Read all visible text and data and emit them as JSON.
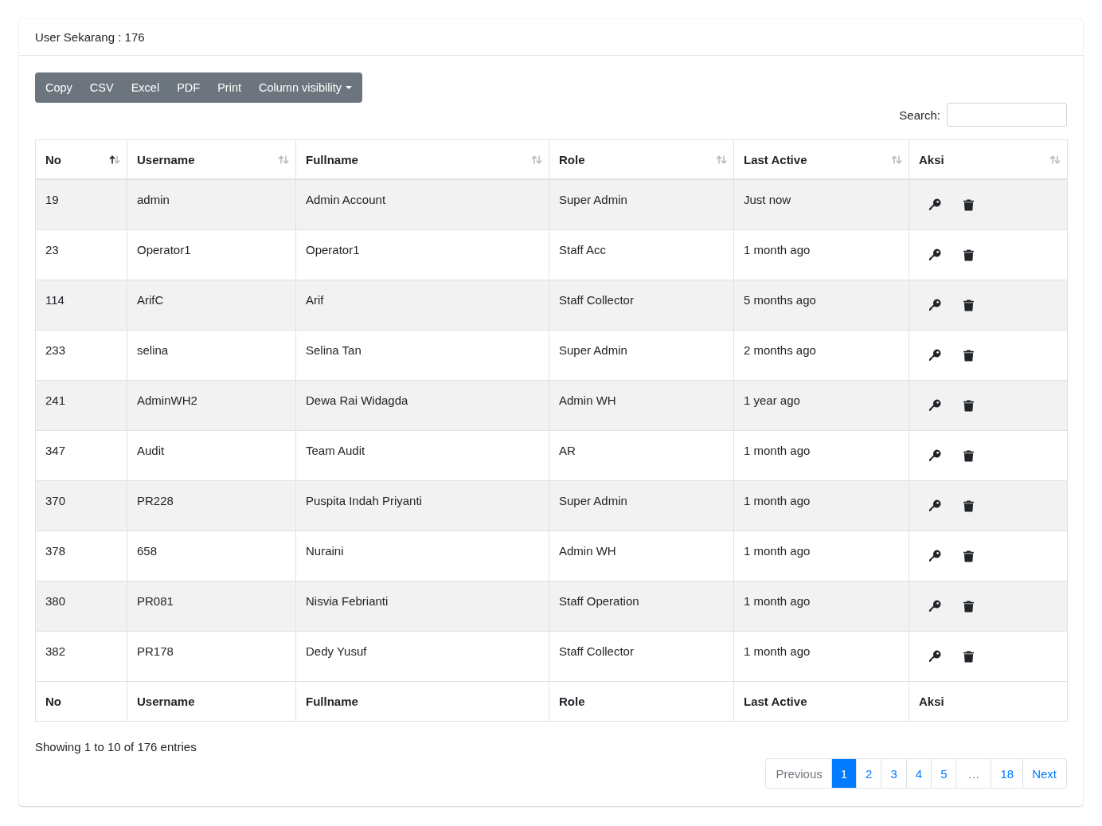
{
  "card": {
    "title": "User Sekarang : 176"
  },
  "buttons": [
    {
      "label": "Copy",
      "dropdown": false
    },
    {
      "label": "CSV",
      "dropdown": false
    },
    {
      "label": "Excel",
      "dropdown": false
    },
    {
      "label": "PDF",
      "dropdown": false
    },
    {
      "label": "Print",
      "dropdown": false
    },
    {
      "label": "Column visibility",
      "dropdown": true
    }
  ],
  "search": {
    "label": "Search:"
  },
  "table": {
    "columns": [
      {
        "label": "No",
        "sort_ascending": true
      },
      {
        "label": "Username",
        "sort_ascending": false
      },
      {
        "label": "Fullname",
        "sort_ascending": false
      },
      {
        "label": "Role",
        "sort_ascending": false
      },
      {
        "label": "Last Active",
        "sort_ascending": false
      },
      {
        "label": "Aksi",
        "sort_ascending": false
      }
    ],
    "rows": [
      [
        "19",
        "admin",
        "Admin Account",
        "Super Admin",
        "Just now"
      ],
      [
        "23",
        "Operator1",
        "Operator1",
        "Staff Acc",
        "1 month ago"
      ],
      [
        "114",
        "ArifC",
        "Arif",
        "Staff Collector",
        "5 months ago"
      ],
      [
        "233",
        "selina",
        "Selina Tan",
        "Super Admin",
        "2 months ago"
      ],
      [
        "241",
        "AdminWH2",
        "Dewa Rai Widagda",
        "Admin WH",
        "1 year ago"
      ],
      [
        "347",
        "Audit",
        "Team Audit",
        "AR",
        "1 month ago"
      ],
      [
        "370",
        "PR228",
        "Puspita Indah Priyanti",
        "Super Admin",
        "1 month ago"
      ],
      [
        "378",
        "658",
        "Nuraini",
        "Admin WH",
        "1 month ago"
      ],
      [
        "380",
        "PR081",
        "Nisvia Febrianti",
        "Staff Operation",
        "1 month ago"
      ],
      [
        "382",
        "PR178",
        "Dedy Yusuf",
        "Staff Collector",
        "1 month ago"
      ]
    ],
    "footer": [
      "No",
      "Username",
      "Fullname",
      "Role",
      "Last Active",
      "Aksi"
    ]
  },
  "info": "Showing 1 to 10 of 176 entries",
  "pagination": [
    {
      "kind": "link",
      "label": "Previous",
      "selected": false,
      "disabled": true
    },
    {
      "kind": "link",
      "label": "1",
      "selected": true,
      "disabled": false
    },
    {
      "kind": "link",
      "label": "2",
      "selected": false,
      "disabled": false
    },
    {
      "kind": "link",
      "label": "3",
      "selected": false,
      "disabled": false
    },
    {
      "kind": "link",
      "label": "4",
      "selected": false,
      "disabled": false
    },
    {
      "kind": "link",
      "label": "5",
      "selected": false,
      "disabled": false
    },
    {
      "kind": "ellipsis",
      "label": "…",
      "selected": false,
      "disabled": true
    },
    {
      "kind": "link",
      "label": "18",
      "selected": false,
      "disabled": false
    },
    {
      "kind": "link",
      "label": "Next",
      "selected": false,
      "disabled": false
    }
  ]
}
